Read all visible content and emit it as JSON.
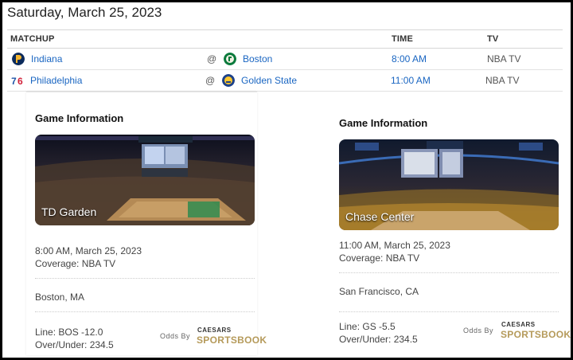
{
  "header": {
    "date": "Saturday, March 25, 2023"
  },
  "table": {
    "columns": {
      "matchup": "MATCHUP",
      "time": "TIME",
      "tv": "TV"
    },
    "rows": [
      {
        "away": "Indiana",
        "at": "@",
        "home": "Boston",
        "time": "8:00 AM",
        "tv": "NBA TV"
      },
      {
        "away": "Philadelphia",
        "at": "@",
        "home": "Golden State",
        "time": "11:00 AM",
        "tv": "NBA TV"
      }
    ]
  },
  "games": [
    {
      "title": "Game Information",
      "arena": "TD Garden",
      "datetime": "8:00 AM, March 25, 2023",
      "coverage": "Coverage: NBA TV",
      "location": "Boston, MA",
      "line": "Line: BOS -12.0",
      "over_under": "Over/Under: 234.5",
      "odds_by": "Odds By",
      "brand_top": "CAESARS",
      "brand_bottom": "SPORTSBOOK"
    },
    {
      "title": "Game Information",
      "arena": "Chase Center",
      "datetime": "11:00 AM, March 25, 2023",
      "coverage": "Coverage: NBA TV",
      "location": "San Francisco, CA",
      "line": "Line: GS -5.5",
      "over_under": "Over/Under: 234.5",
      "odds_by": "Odds By",
      "brand_top": "CAESARS",
      "brand_bottom": "SPORTSBOOK"
    }
  ],
  "colors": {
    "link": "#1a66c2",
    "brand_gold": "#b59a5a"
  }
}
